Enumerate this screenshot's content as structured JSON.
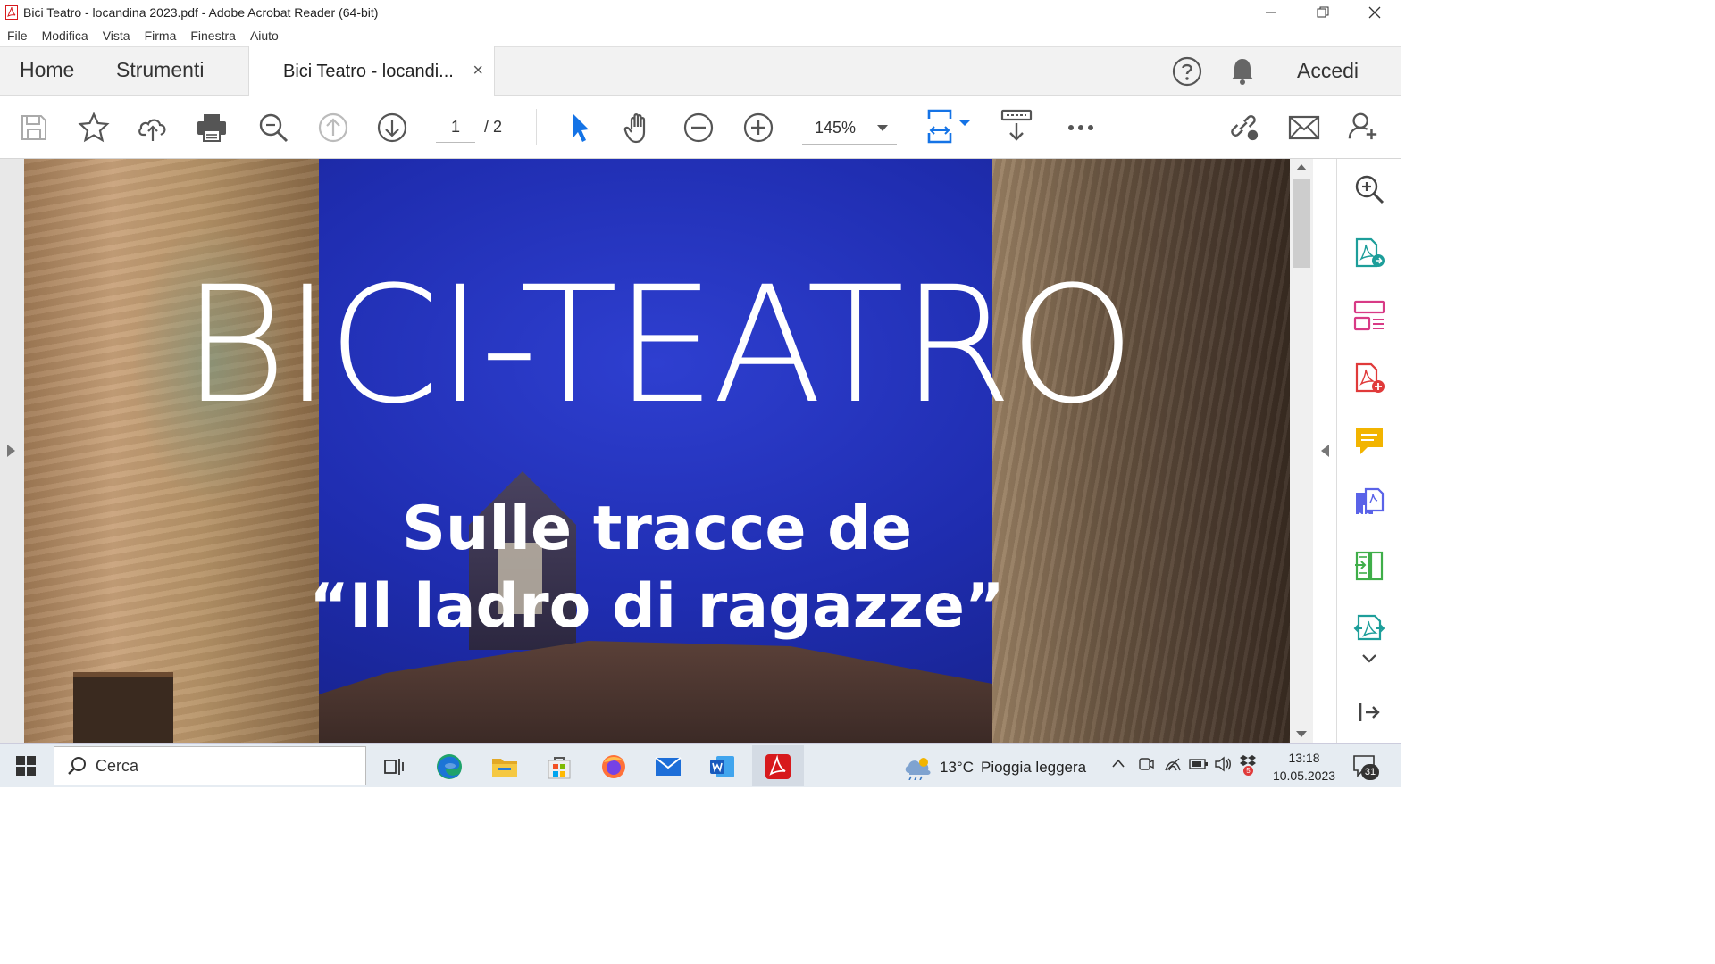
{
  "window": {
    "title": "Bici Teatro - locandina 2023.pdf - Adobe Acrobat Reader (64-bit)"
  },
  "menu": [
    "File",
    "Modifica",
    "Vista",
    "Firma",
    "Finestra",
    "Aiuto"
  ],
  "tabs": {
    "home": "Home",
    "tools": "Strumenti",
    "document": "Bici Teatro - locandi...",
    "close": "×"
  },
  "header": {
    "signin": "Accedi"
  },
  "toolbar": {
    "page_current": "1",
    "page_total": "/ 2",
    "zoom": "145%"
  },
  "document": {
    "title": "BICI-TEATRO",
    "subtitle_line1": "Sulle tracce de",
    "subtitle_line2": "“Il ladro di ragazze”"
  },
  "taskbar": {
    "search_placeholder": "Cerca",
    "weather_temp": "13°C",
    "weather_desc": "Pioggia leggera",
    "time": "13:18",
    "date": "10.05.2023",
    "notification_count": "31",
    "badge_count": "5"
  },
  "colors": {
    "acrobat_red": "#d7191c",
    "accent_blue": "#1473e6",
    "sky_blue": "#1f2db0"
  }
}
